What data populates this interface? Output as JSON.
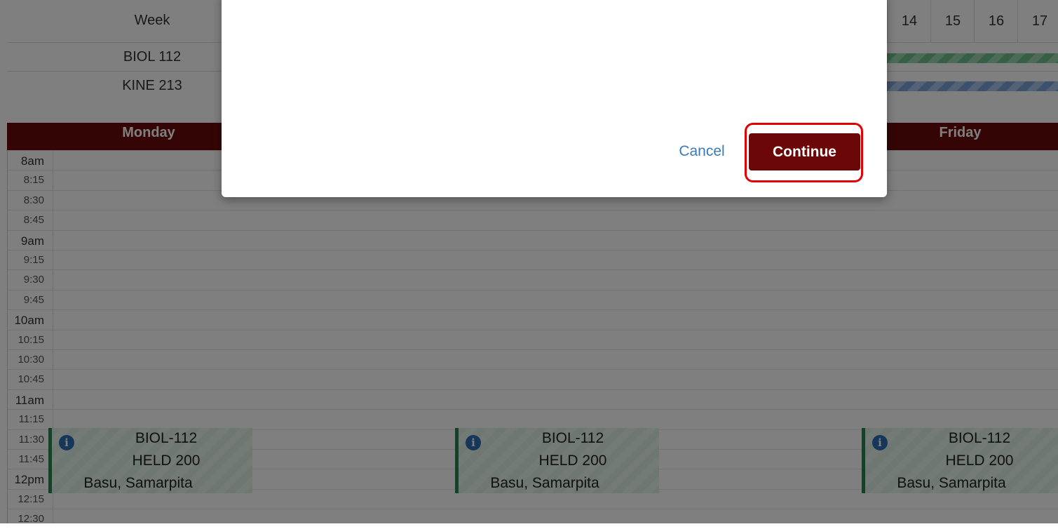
{
  "week_strip": {
    "header_label": "Week",
    "week_numbers": [
      "14",
      "15",
      "16",
      "17"
    ],
    "courses": [
      {
        "label": "BIOL 112",
        "color": "#6fbf8d"
      },
      {
        "label": "KINE 213",
        "color": "#7aa3d8"
      }
    ]
  },
  "calendar": {
    "days": [
      "Monday",
      "Friday"
    ],
    "times": [
      "8am",
      "8:15",
      "8:30",
      "8:45",
      "9am",
      "9:15",
      "9:30",
      "9:45",
      "10am",
      "10:15",
      "10:30",
      "10:45",
      "11am",
      "11:15",
      "11:30",
      "11:45",
      "12pm",
      "12:15",
      "12:30"
    ],
    "hour_labels": [
      "8am",
      "9am",
      "10am",
      "11am",
      "12pm"
    ],
    "events": [
      {
        "course": "BIOL-112",
        "room": "HELD 200",
        "instructor": "Basu, Samarpita"
      },
      {
        "course": "BIOL-112",
        "room": "HELD 200",
        "instructor": "Basu, Samarpita"
      },
      {
        "course": "BIOL-112",
        "room": "HELD 200",
        "instructor": "Basu, Samarpita"
      }
    ],
    "event_accent": "#1f8a4a",
    "header_color": "#6b0a0a"
  },
  "modal": {
    "cancel_label": "Cancel",
    "continue_label": "Continue",
    "continue_color": "#6b0707",
    "highlight_color": "#e00000"
  }
}
